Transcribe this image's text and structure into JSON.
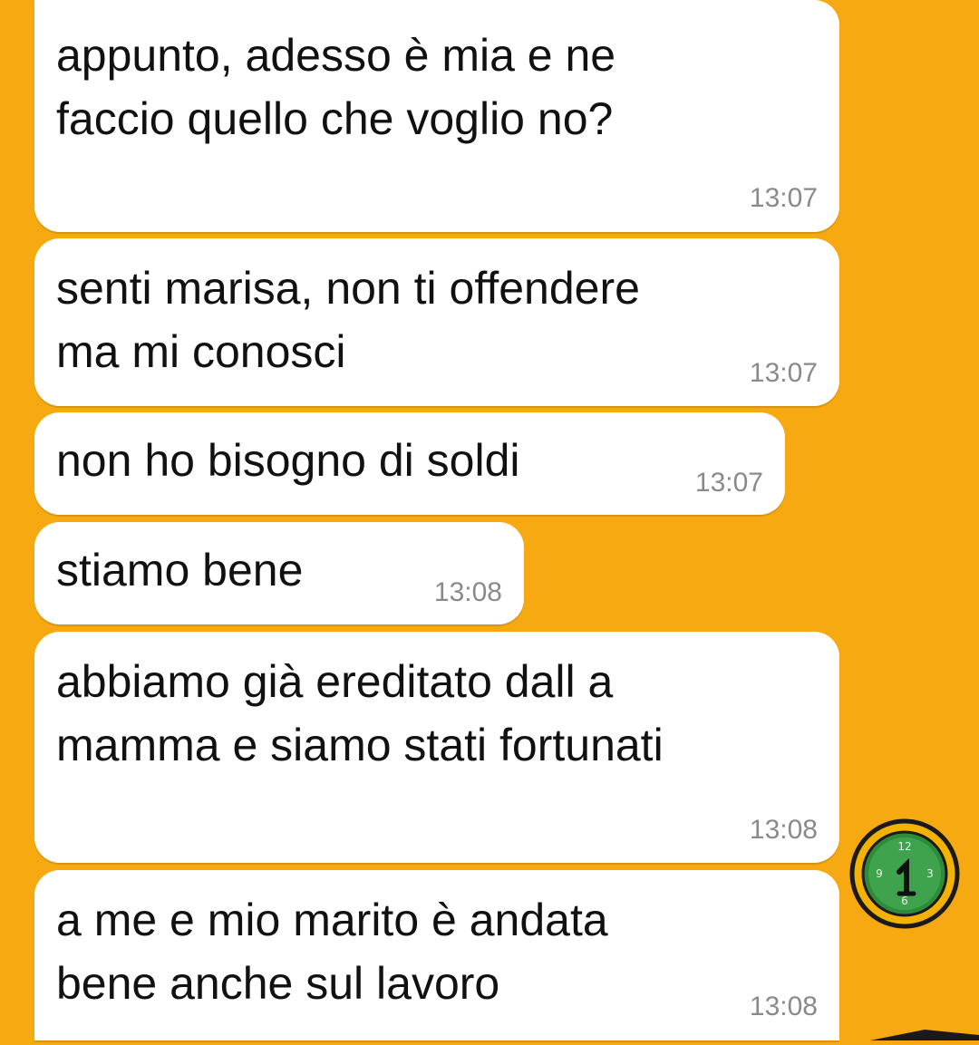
{
  "colors": {
    "background": "#F7A912",
    "bubble": "#FFFFFF",
    "message_text": "#111111",
    "timestamp": "#8A8A8A"
  },
  "messages": [
    {
      "text": "appunto, adesso è mia e ne\nfaccio quello che voglio no?",
      "time": "13:07"
    },
    {
      "text": "senti marisa, non ti offendere\nma mi conosci",
      "time": "13:07"
    },
    {
      "text": "non ho bisogno di soldi",
      "time": "13:07"
    },
    {
      "text": "stiamo bene",
      "time": "13:08"
    },
    {
      "text": "abbiamo già ereditato dall a\nmamma e siamo stati fortunati",
      "time": "13:08"
    },
    {
      "text": "a me e mio marito è andata\nbene anche sul lavoro",
      "time": "13:08"
    }
  ],
  "decorations": {
    "clock_sticker": "clock-sticker-icon"
  }
}
